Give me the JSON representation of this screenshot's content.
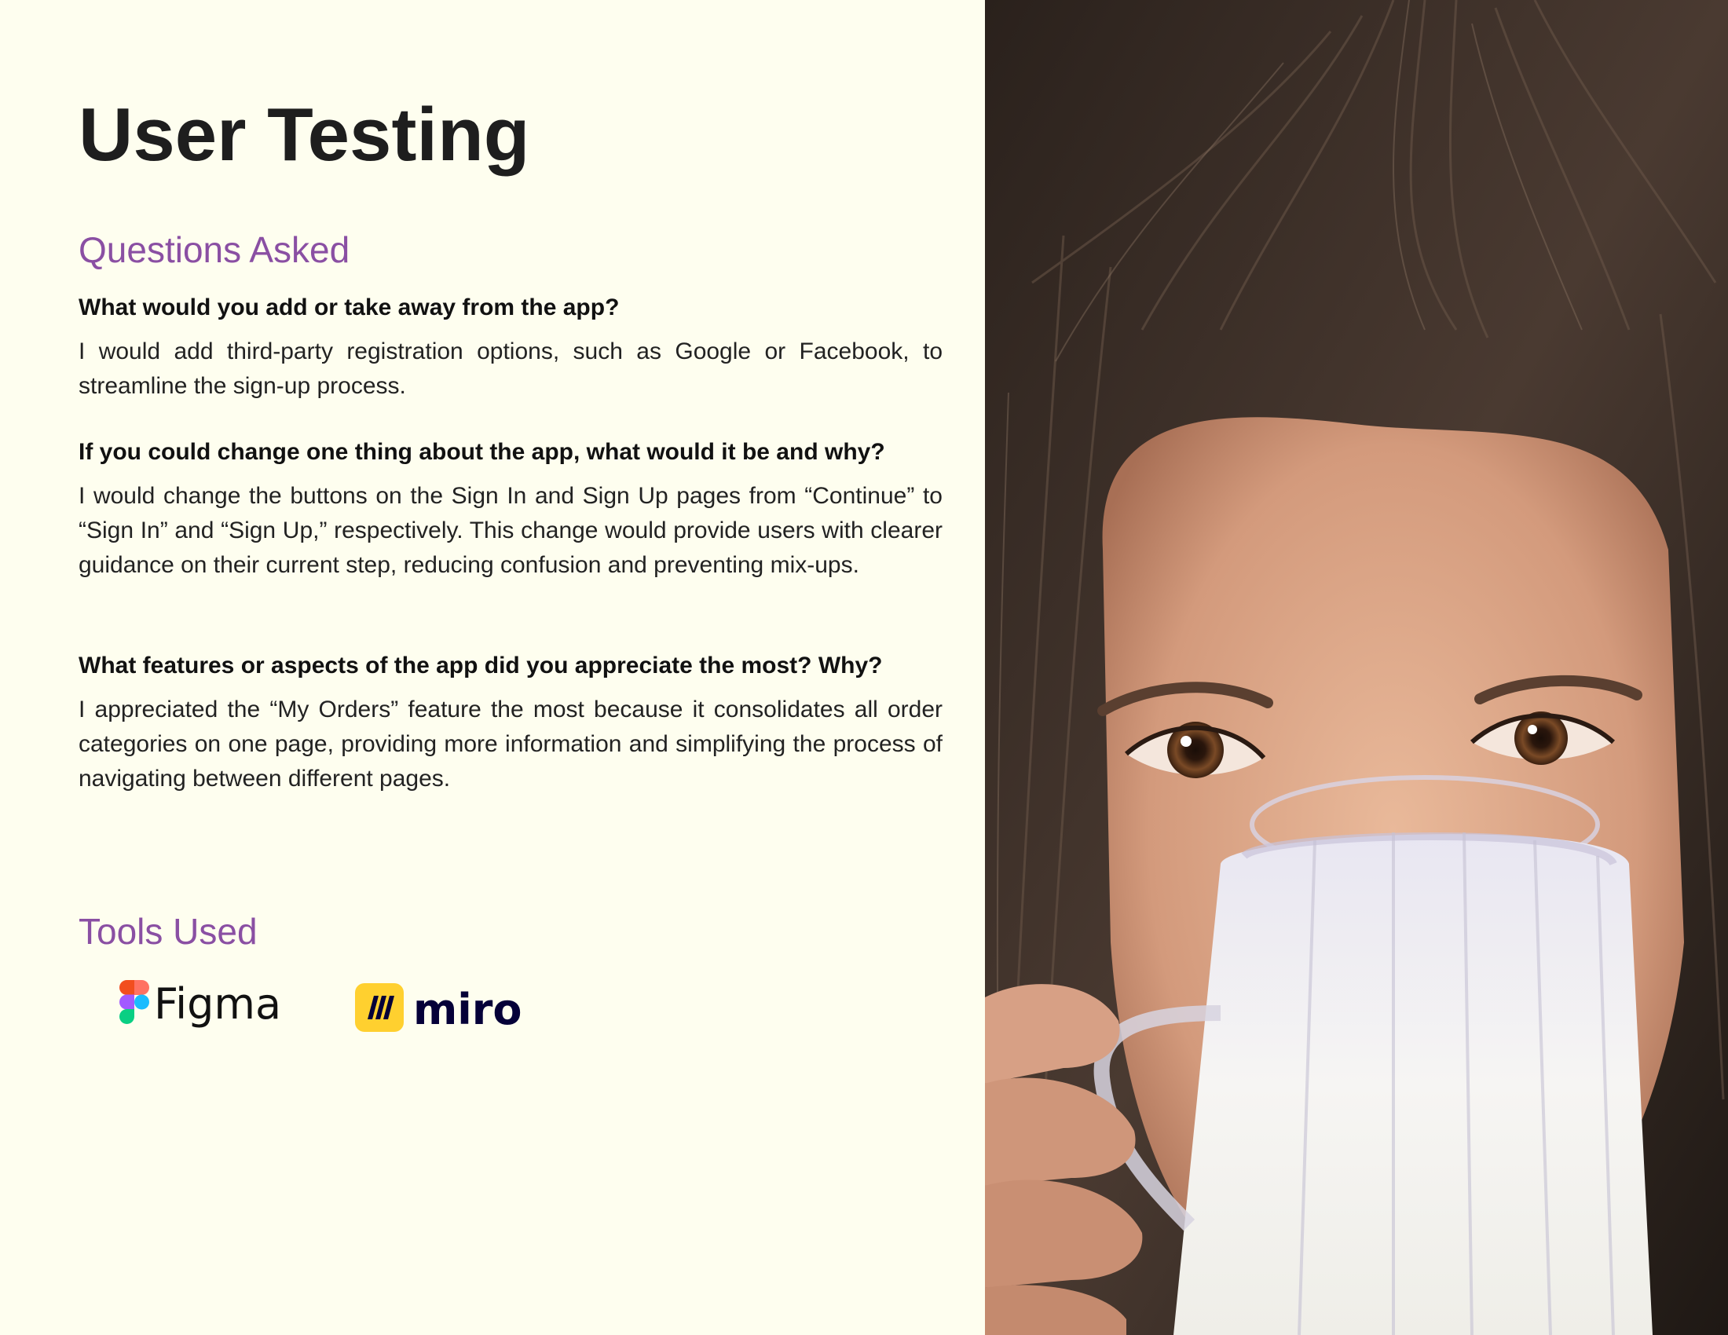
{
  "page": {
    "title": "User Testing",
    "background_color": "#fefeef",
    "accent_color": "#8a4fa3"
  },
  "questions_section": {
    "heading": "Questions Asked",
    "items": [
      {
        "question": "What would you add or take away from the app?",
        "answer": "I would add third-party registration options, such as Google or Facebook, to streamline the sign-up process."
      },
      {
        "question": "If you could change one thing about the app, what would it be and why?",
        "answer": "I would change the buttons on the Sign In and Sign Up pages from “Continue” to “Sign In” and “Sign Up,” respectively. This change would provide users with clearer guidance on their current step, reducing confusion and preventing mix-ups."
      },
      {
        "question": "What features or aspects of the app did you appreciate the most? Why?",
        "answer": "I appreciated the “My Orders” feature the most because it consolidates all order categories on one page, providing more information and simplifying the process of navigating between different pages."
      }
    ]
  },
  "tools_section": {
    "heading": "Tools Used",
    "tools": [
      {
        "name": "Figma",
        "icon": "figma-logo-icon"
      },
      {
        "name": "miro",
        "icon": "miro-logo-icon",
        "brand_color": "#ffd02f"
      }
    ]
  },
  "photo": {
    "subject": "girl-drinking-milk-photo"
  }
}
